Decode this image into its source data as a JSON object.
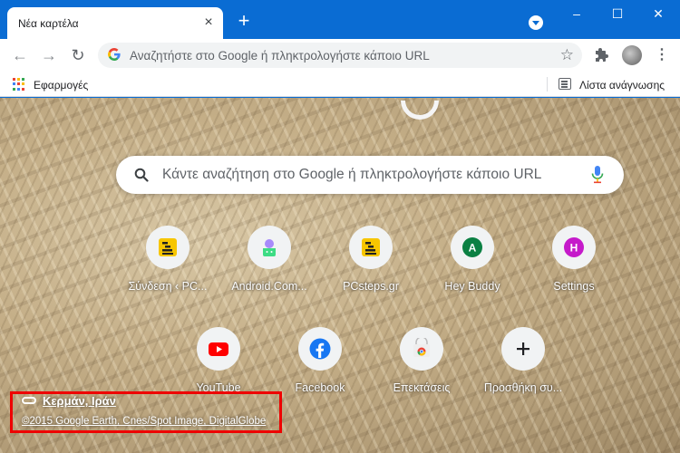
{
  "tab": {
    "title": "Νέα καρτέλα",
    "close_icon": "close-icon"
  },
  "window": {
    "minimize": "–",
    "maximize": "☐",
    "close": "✕"
  },
  "toolbar": {
    "omnibox_placeholder": "Αναζητήστε στο Google ή πληκτρολογήστε κάποιο URL"
  },
  "bookmarks": {
    "apps_label": "Εφαρμογές",
    "reading_list_label": "Λίστα ανάγνωσης"
  },
  "ntp": {
    "search_placeholder": "Κάντε αναζήτηση στο Google ή πληκτρολογήστε κάποιο URL",
    "shortcuts": [
      {
        "label": "Σύνδεση ‹ PC...",
        "icon": "pcsteps-icon"
      },
      {
        "label": "Android.Com...",
        "icon": "android-icon"
      },
      {
        "label": "PCsteps.gr",
        "icon": "pcsteps-icon"
      },
      {
        "label": "Hey Buddy",
        "icon": "letter-a-icon",
        "letter": "A",
        "color": "#0b8043"
      },
      {
        "label": "Settings",
        "icon": "letter-h-icon",
        "letter": "H",
        "color": "#c51aca"
      },
      {
        "label": "YouTube",
        "icon": "youtube-icon"
      },
      {
        "label": "Facebook",
        "icon": "facebook-icon"
      },
      {
        "label": "Επεκτάσεις",
        "icon": "chrome-webstore-icon"
      },
      {
        "label": "Προσθήκη συ...",
        "icon": "plus-icon"
      }
    ],
    "attribution": {
      "location": "Κερμάν, Ιράν",
      "copyright": "©2015 Google Earth, Cnes/Spot Image, DigitalGlobe"
    }
  },
  "colors": {
    "titlebar": "#0a6cd3",
    "highlight": "#e00000"
  }
}
